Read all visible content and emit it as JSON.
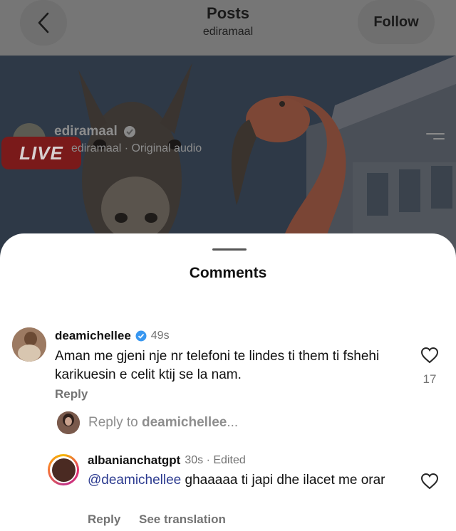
{
  "header": {
    "title": "Posts",
    "subtitle": "ediramaal",
    "follow_label": "Follow"
  },
  "post": {
    "username": "ediramaal",
    "audio": "ediramaal · Original audio",
    "live_badge": "LIVE"
  },
  "sheet": {
    "title": "Comments"
  },
  "comments": [
    {
      "username": "deamichellee",
      "time": "49s",
      "text": "Aman me gjeni nje nr telefoni te lindes ti them ti fshehi karikuesin e celit ktij se la nam.",
      "reply_label": "Reply",
      "likes": "17"
    }
  ],
  "reply_box": {
    "prefix": "Reply to ",
    "target": "deamichellee",
    "suffix": "..."
  },
  "reply": {
    "username": "albanianchatgpt",
    "meta": "30s · Edited",
    "mention": "@deamichellee",
    "text": " ghaaaaa ti japi dhe ilacet me orar",
    "reply_label": "Reply",
    "translate_label": "See translation"
  }
}
